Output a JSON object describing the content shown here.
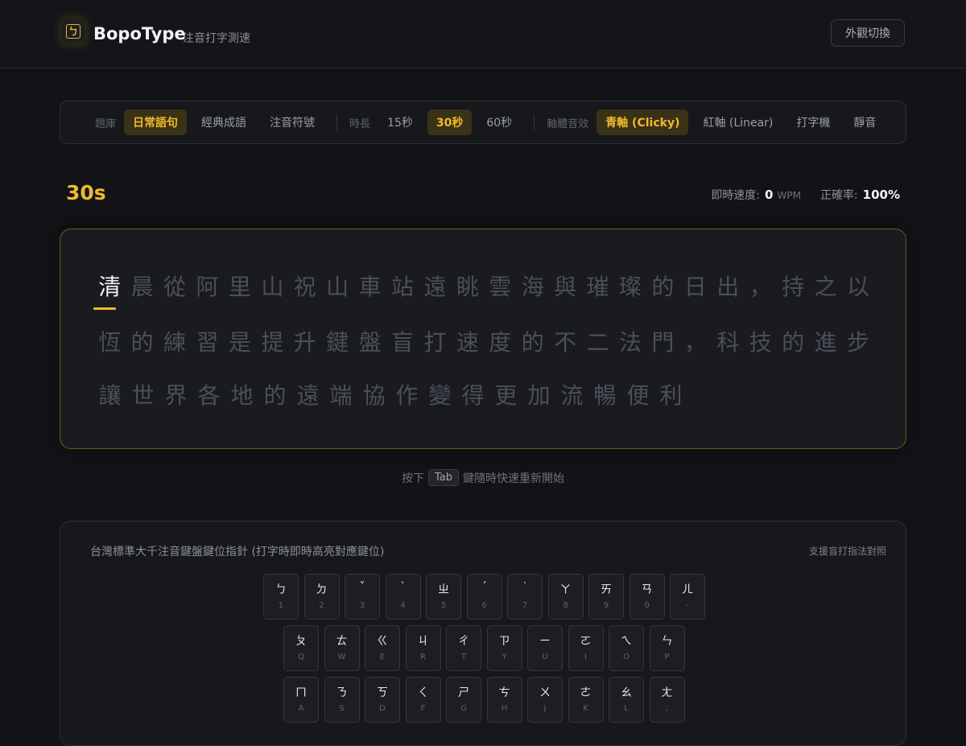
{
  "header": {
    "logo_glyph": "ㄅ",
    "title": "BopoType",
    "subtitle": "注音打字測速",
    "theme_button": "外觀切換"
  },
  "options": {
    "bank_label": "題庫",
    "banks": [
      "日常語句",
      "經典成語",
      "注音符號"
    ],
    "active_bank": "日常語句",
    "duration_label": "時長",
    "durations": [
      "15秒",
      "30秒",
      "60秒"
    ],
    "active_duration": "30秒",
    "sound_label": "軸體音效",
    "sounds": [
      "青軸 (Clicky)",
      "紅軸 (Linear)",
      "打字機",
      "靜音"
    ],
    "active_sound": "青軸 (Clicky)"
  },
  "stats": {
    "timer": "30s",
    "speed_label": "即時速度:",
    "speed_value": "0",
    "speed_unit": "WPM",
    "accuracy_label": "正確率:",
    "accuracy_value": "100%"
  },
  "passage": {
    "line1": "清晨從阿里山祝山車站遠眺雲海與璀璨的日出，持之以",
    "line2": "恆的練習是提升鍵盤盲打速度的不二法門，科技的進步",
    "line3": "讓世界各地的遠端協作變得更加流暢便利",
    "current_index": 0
  },
  "hint": {
    "prefix": "按下",
    "key": "Tab",
    "suffix": "鍵隨時快速重新開始"
  },
  "keyboard": {
    "title": "台灣標準大千注音鍵盤鍵位指針 (打字時即時高亮對應鍵位)",
    "note": "支援盲打指法對照",
    "rows": [
      [
        [
          "ㄅ",
          "1"
        ],
        [
          "ㄉ",
          "2"
        ],
        [
          "ˇ",
          "3"
        ],
        [
          "ˋ",
          "4"
        ],
        [
          "ㄓ",
          "5"
        ],
        [
          "ˊ",
          "6"
        ],
        [
          "˙",
          "7"
        ],
        [
          "ㄚ",
          "8"
        ],
        [
          "ㄞ",
          "9"
        ],
        [
          "ㄢ",
          "0"
        ],
        [
          "ㄦ",
          "-"
        ]
      ],
      [
        [
          "ㄆ",
          "Q"
        ],
        [
          "ㄊ",
          "W"
        ],
        [
          "ㄍ",
          "E"
        ],
        [
          "ㄐ",
          "R"
        ],
        [
          "ㄔ",
          "T"
        ],
        [
          "ㄗ",
          "Y"
        ],
        [
          "ㄧ",
          "U"
        ],
        [
          "ㄛ",
          "I"
        ],
        [
          "ㄟ",
          "O"
        ],
        [
          "ㄣ",
          "P"
        ]
      ],
      [
        [
          "ㄇ",
          "A"
        ],
        [
          "ㄋ",
          "S"
        ],
        [
          "ㄎ",
          "D"
        ],
        [
          "ㄑ",
          "F"
        ],
        [
          "ㄕ",
          "G"
        ],
        [
          "ㄘ",
          "H"
        ],
        [
          "ㄨ",
          "J"
        ],
        [
          "ㄜ",
          "K"
        ],
        [
          "ㄠ",
          "L"
        ],
        [
          "ㄤ",
          ";"
        ]
      ]
    ]
  }
}
